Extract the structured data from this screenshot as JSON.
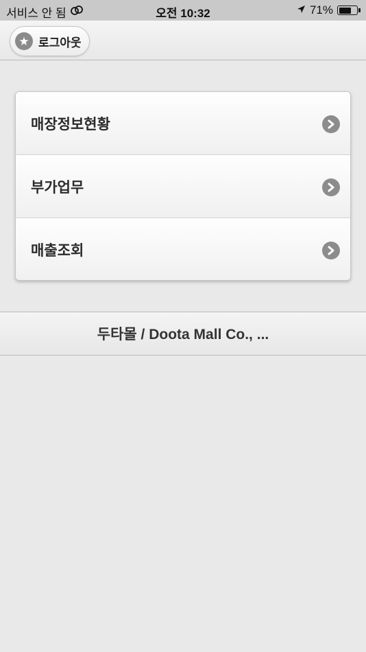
{
  "status_bar": {
    "carrier": "서비스 안 됨",
    "time": "오전 10:32",
    "battery": "71%",
    "battery_level": 0.71
  },
  "header": {
    "logout_label": "로그아웃",
    "logout_icon": "star-icon"
  },
  "menu": {
    "items": [
      {
        "label": "매장정보현황",
        "icon": "chevron-right-icon"
      },
      {
        "label": "부가업무",
        "icon": "chevron-right-icon"
      },
      {
        "label": "매출조회",
        "icon": "chevron-right-icon"
      }
    ]
  },
  "footer": {
    "text": "두타몰 / Doota Mall Co., ..."
  }
}
